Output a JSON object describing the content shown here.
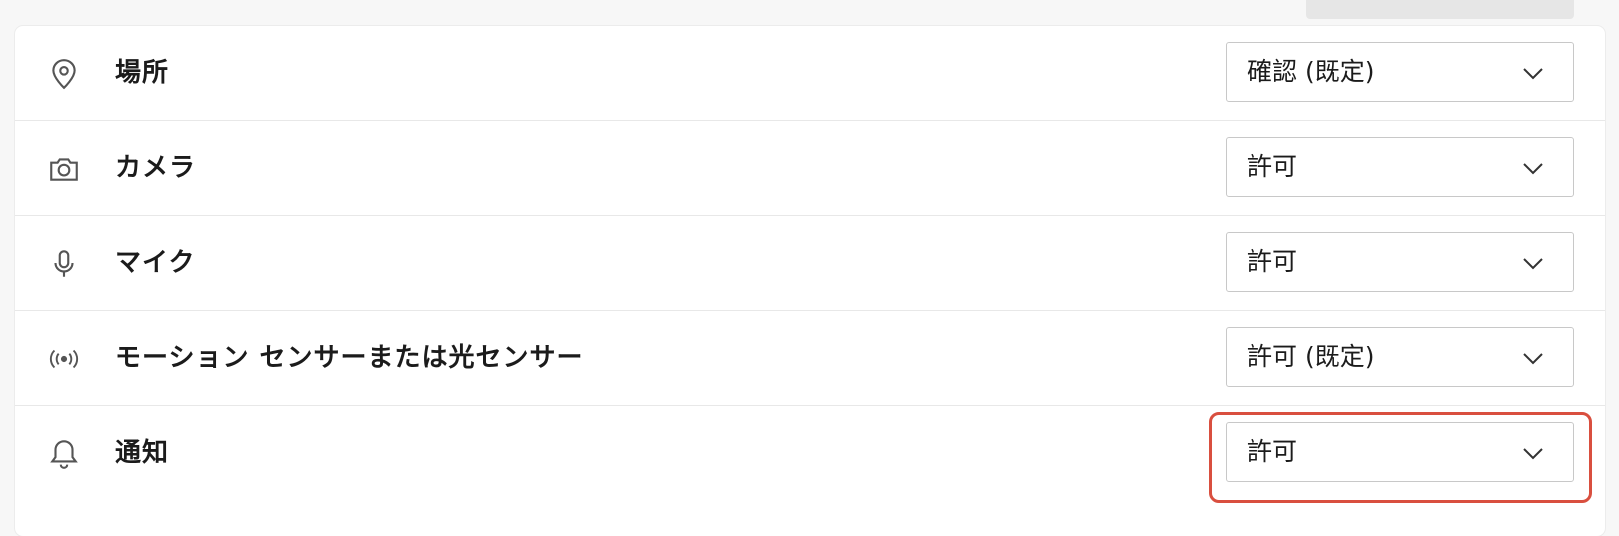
{
  "permissions": [
    {
      "id": "location",
      "icon": "location-pin-icon",
      "label": "場所",
      "value": "確認 (既定)"
    },
    {
      "id": "camera",
      "icon": "camera-icon",
      "label": "カメラ",
      "value": "許可"
    },
    {
      "id": "microphone",
      "icon": "microphone-icon",
      "label": "マイク",
      "value": "許可"
    },
    {
      "id": "motion-sensor",
      "icon": "motion-sensor-icon",
      "label": "モーション センサーまたは光センサー",
      "value": "許可 (既定)"
    },
    {
      "id": "notifications",
      "icon": "bell-icon",
      "label": "通知",
      "value": "許可"
    }
  ],
  "highlight": {
    "target": "notifications",
    "color": "#d94f3f"
  }
}
